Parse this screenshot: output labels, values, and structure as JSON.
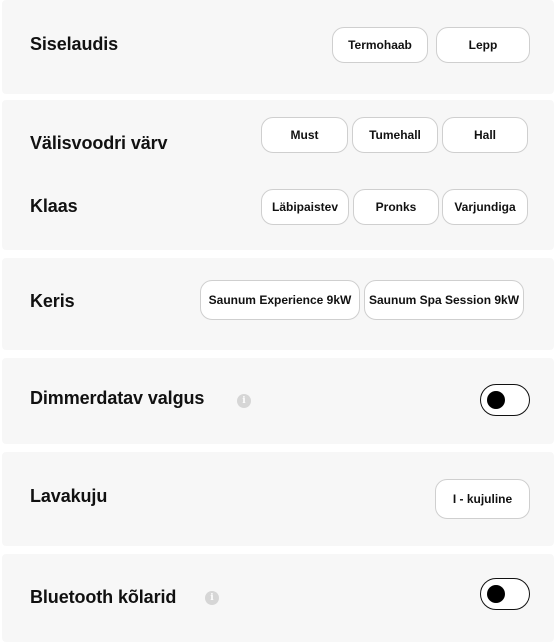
{
  "sections": {
    "siselaudis": {
      "label": "Siselaudis",
      "options": [
        "Termohaab",
        "Lepp"
      ]
    },
    "valisvoodri": {
      "label": "Välisvoodri värv",
      "options": [
        "Must",
        "Tumehall",
        "Hall"
      ]
    },
    "klaas": {
      "label": "Klaas",
      "options": [
        "Läbipaistev",
        "Pronks",
        "Varjundiga"
      ]
    },
    "keris": {
      "label": "Keris",
      "options": [
        "Saunum Experience 9kW",
        "Saunum Spa Session 9kW"
      ]
    },
    "dimmer": {
      "label": "Dimmerdatav valgus",
      "info_icon": "info-icon",
      "toggle_on": false
    },
    "lavakuju": {
      "label": "Lavakuju",
      "options": [
        "I - kujuline"
      ]
    },
    "bluetooth": {
      "label": "Bluetooth kõlarid",
      "info_icon": "info-icon",
      "toggle_on": false
    }
  },
  "info_glyph": "i"
}
